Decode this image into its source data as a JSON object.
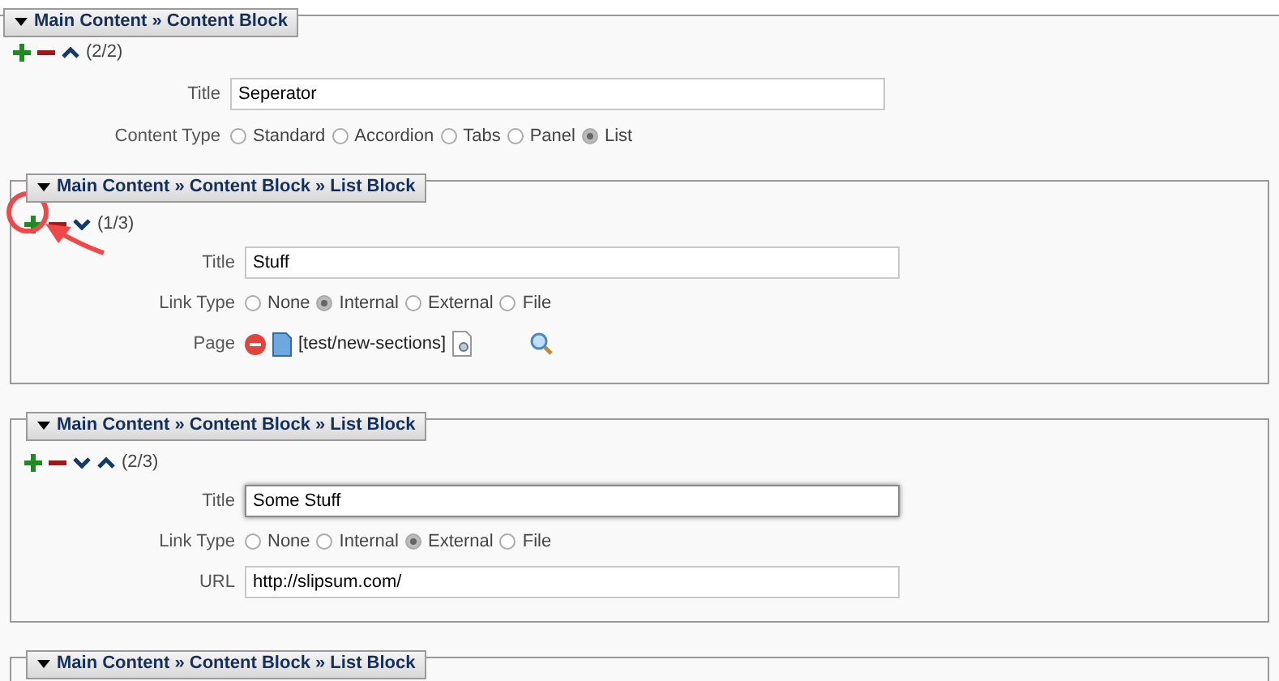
{
  "block": {
    "legend": "Main Content » Content Block",
    "expanded": true,
    "controls": [
      {
        "kind": "add"
      },
      {
        "kind": "remove"
      },
      {
        "kind": "up"
      }
    ],
    "counter": "(2/2)",
    "fields": [
      {
        "kind": "text",
        "label": "Title",
        "value": "Seperator",
        "focused": false
      },
      {
        "kind": "radio",
        "label": "Content Type",
        "options": [
          {
            "label": "Standard",
            "selected": false
          },
          {
            "label": "Accordion",
            "selected": false
          },
          {
            "label": "Tabs",
            "selected": false
          },
          {
            "label": "Panel",
            "selected": false
          },
          {
            "label": "List",
            "selected": true
          }
        ]
      }
    ],
    "children": [
      {
        "legend": "Main Content » Content Block » List Block",
        "expanded": true,
        "annotated": true,
        "controls": [
          {
            "kind": "add"
          },
          {
            "kind": "remove"
          },
          {
            "kind": "down"
          }
        ],
        "counter": "(1/3)",
        "fields": [
          {
            "kind": "text",
            "label": "Title",
            "value": "Stuff",
            "focused": false
          },
          {
            "kind": "radio",
            "label": "Link Type",
            "options": [
              {
                "label": "None",
                "selected": false
              },
              {
                "label": "Internal",
                "selected": true
              },
              {
                "label": "External",
                "selected": false
              },
              {
                "label": "File",
                "selected": false
              }
            ]
          },
          {
            "kind": "page",
            "label": "Page",
            "value": "[test/new-sections]"
          }
        ]
      },
      {
        "legend": "Main Content » Content Block » List Block",
        "expanded": true,
        "annotated": false,
        "controls": [
          {
            "kind": "add"
          },
          {
            "kind": "remove"
          },
          {
            "kind": "down"
          },
          {
            "kind": "up"
          }
        ],
        "counter": "(2/3)",
        "fields": [
          {
            "kind": "text",
            "label": "Title",
            "value": "Some Stuff",
            "focused": true
          },
          {
            "kind": "radio",
            "label": "Link Type",
            "options": [
              {
                "label": "None",
                "selected": false
              },
              {
                "label": "Internal",
                "selected": false
              },
              {
                "label": "External",
                "selected": true
              },
              {
                "label": "File",
                "selected": false
              }
            ]
          },
          {
            "kind": "text",
            "label": "URL",
            "value": "http://slipsum.com/",
            "focused": false
          }
        ]
      },
      {
        "legend": "Main Content » Content Block » List Block",
        "expanded": true,
        "annotated": false
      }
    ]
  }
}
